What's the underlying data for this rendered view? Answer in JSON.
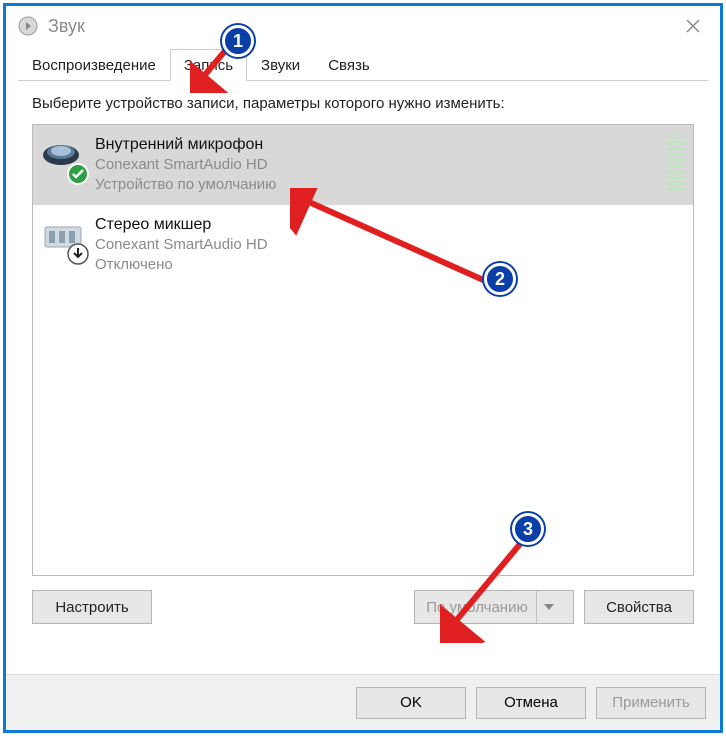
{
  "window": {
    "title": "Звук"
  },
  "tabs": {
    "playback": "Воспроизведение",
    "recording": "Запись",
    "sounds": "Звуки",
    "communications": "Связь"
  },
  "instruction": "Выберите устройство записи, параметры которого нужно изменить:",
  "devices": [
    {
      "name": "Внутренний микрофон",
      "driver": "Conexant SmartAudio HD",
      "status": "Устройство по умолчанию"
    },
    {
      "name": "Стерео микшер",
      "driver": "Conexant SmartAudio HD",
      "status": "Отключено"
    }
  ],
  "buttons": {
    "configure": "Настроить",
    "default": "По умолчанию",
    "properties": "Свойства"
  },
  "dialog_buttons": {
    "ok": "OK",
    "cancel": "Отмена",
    "apply": "Применить"
  },
  "annotations": {
    "b1": "1",
    "b2": "2",
    "b3": "3"
  }
}
